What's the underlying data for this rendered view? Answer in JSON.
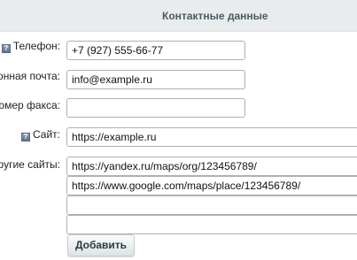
{
  "section": {
    "title": "Контактные данные"
  },
  "fields": {
    "phone": {
      "label": "Телефон:",
      "value": "+7 (927) 555-66-77"
    },
    "email": {
      "label": "ронная почта:",
      "value": "info@example.ru"
    },
    "fax": {
      "label": "Номер факса:",
      "value": ""
    },
    "site": {
      "label": "Сайт:",
      "value": "https://example.ru"
    },
    "other_sites": {
      "label": "другие сайты:",
      "values": [
        "https://yandex.ru/maps/org/123456789/",
        "https://www.google.com/maps/place/123456789/",
        "",
        ""
      ]
    }
  },
  "add_button_label": "Добавить",
  "icons": {
    "help": "help-icon"
  }
}
